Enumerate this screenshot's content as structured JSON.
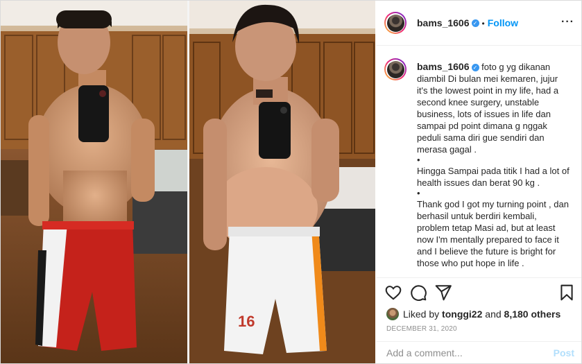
{
  "post": {
    "username": "bams_1606",
    "verified_mark": "✓",
    "follow_label": "Follow",
    "more_icon": "more-horizontal-icon"
  },
  "caption": {
    "username": "bams_1606",
    "paragraphs": [
      "foto g yg dikanan diambil Di bulan mei kemaren, jujur it's the lowest point in my life, had a second knee surgery, unstable business, lots of issues in life dan sampai pd point dimana g nggak peduli sama diri gue sendiri dan merasa gagal .",
      "Hingga Sampai pada titik I had a lot of health issues dan berat 90 kg .",
      "Thank god I got my turning point , dan berhasil untuk berdiri kembali, problem tetap Masi ad, but at least now I'm mentally prepared to face it and I believe the future is bright for those who put hope in life ."
    ],
    "bullet": "•"
  },
  "footer": {
    "liked_prefix": "Liked by",
    "liked_user": "tonggi22",
    "liked_and": "and",
    "liked_count": "8,180 others",
    "date": "DECEMBER 31, 2020",
    "comment_placeholder": "Add a comment...",
    "post_label": "Post"
  },
  "colors": {
    "accent": "#0095f6",
    "verified": "#3897f0",
    "post_disabled": "#b2dffc"
  }
}
